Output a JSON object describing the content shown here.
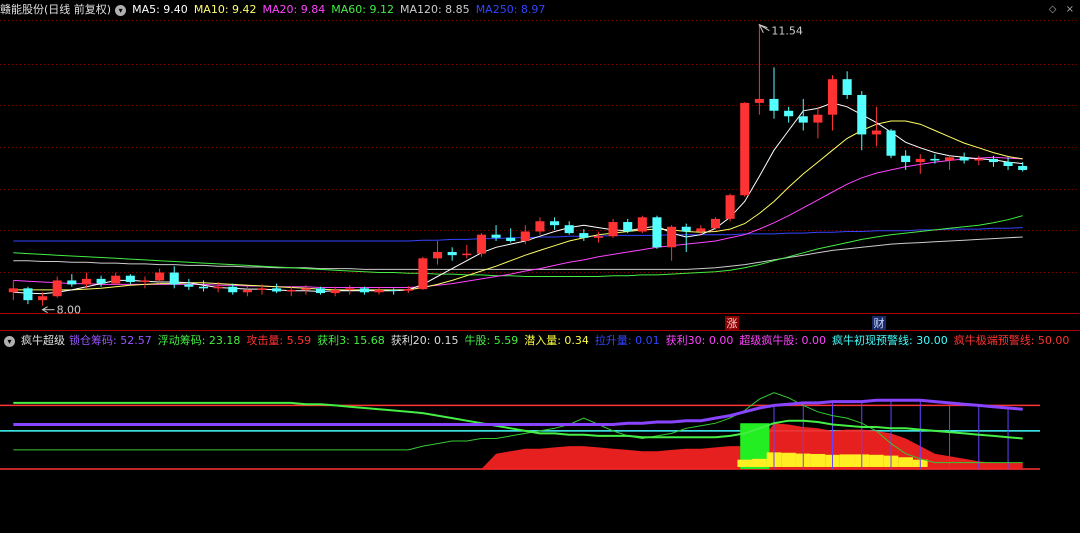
{
  "top": {
    "stock_name": "赣能股份(日线 前复权)",
    "ma": [
      {
        "label": "MA5: 9.40",
        "color": "#ffffff"
      },
      {
        "label": "MA10: 9.42",
        "color": "#ffff66"
      },
      {
        "label": "MA20: 9.84",
        "color": "#ff44ff"
      },
      {
        "label": "MA60: 9.12",
        "color": "#44ee44"
      },
      {
        "label": "MA120: 8.85",
        "color": "#cccccc"
      },
      {
        "label": "MA250: 8.97",
        "color": "#3344ff"
      }
    ],
    "max_label": "11.54",
    "min_label": "8.00",
    "marker_zhang": "涨",
    "marker_cai": "财",
    "corner_up": "◇",
    "corner_close": "×"
  },
  "bottom": {
    "indicator_name": "疯牛超级",
    "items": [
      {
        "label": "锁仓筹码: 52.57",
        "color": "#9955ff"
      },
      {
        "label": "浮动筹码: 23.18",
        "color": "#44ee44"
      },
      {
        "label": "攻击量: 5.59",
        "color": "#ff3333"
      },
      {
        "label": "获利3: 15.68",
        "color": "#44ee44"
      },
      {
        "label": "获利20: 0.15",
        "color": "#dddddd"
      },
      {
        "label": "牛股: 5.59",
        "color": "#44ee44"
      },
      {
        "label": "潜入量: 0.34",
        "color": "#ffff44"
      },
      {
        "label": "拉升量: 0.01",
        "color": "#3344ff"
      },
      {
        "label": "获利30: 0.00",
        "color": "#ff44ff"
      },
      {
        "label": "超级疯牛股: 0.00",
        "color": "#ff44ff"
      },
      {
        "label": "疯牛初现预警线: 30.00",
        "color": "#44ffff"
      },
      {
        "label": "疯牛极端预警线: 50.00",
        "color": "#ff3333"
      }
    ]
  },
  "colors": {
    "up": "#ff3333",
    "down": "#54ffff",
    "grid": "#800000",
    "border": "#aa0000",
    "ma5": "#ffffff",
    "ma10": "#ffff66",
    "ma20": "#ff44ff",
    "ma60": "#44ee44",
    "ma120": "#cccccc",
    "ma250": "#3344ff"
  },
  "chart_data": {
    "type": "candlestick",
    "price_range": [
      7.9,
      11.6
    ],
    "candles": [
      [
        8.15,
        8.3,
        8.05,
        8.2
      ],
      [
        8.2,
        8.22,
        8.0,
        8.05
      ],
      [
        8.05,
        8.15,
        7.98,
        8.1
      ],
      [
        8.1,
        8.35,
        8.08,
        8.3
      ],
      [
        8.3,
        8.38,
        8.22,
        8.25
      ],
      [
        8.25,
        8.4,
        8.2,
        8.32
      ],
      [
        8.32,
        8.36,
        8.22,
        8.26
      ],
      [
        8.26,
        8.4,
        8.24,
        8.36
      ],
      [
        8.36,
        8.38,
        8.25,
        8.28
      ],
      [
        8.28,
        8.35,
        8.2,
        8.3
      ],
      [
        8.3,
        8.45,
        8.26,
        8.4
      ],
      [
        8.4,
        8.48,
        8.2,
        8.25
      ],
      [
        8.25,
        8.32,
        8.18,
        8.22
      ],
      [
        8.22,
        8.3,
        8.16,
        8.2
      ],
      [
        8.2,
        8.28,
        8.15,
        8.22
      ],
      [
        8.22,
        8.26,
        8.12,
        8.15
      ],
      [
        8.15,
        8.22,
        8.1,
        8.18
      ],
      [
        8.18,
        8.25,
        8.12,
        8.2
      ],
      [
        8.2,
        8.26,
        8.14,
        8.16
      ],
      [
        8.16,
        8.22,
        8.1,
        8.18
      ],
      [
        8.18,
        8.24,
        8.12,
        8.2
      ],
      [
        8.2,
        8.22,
        8.12,
        8.14
      ],
      [
        8.14,
        8.22,
        8.1,
        8.18
      ],
      [
        8.18,
        8.24,
        8.12,
        8.2
      ],
      [
        8.2,
        8.22,
        8.12,
        8.15
      ],
      [
        8.15,
        8.22,
        8.12,
        8.18
      ],
      [
        8.18,
        8.2,
        8.12,
        8.17
      ],
      [
        8.17,
        8.23,
        8.14,
        8.19
      ],
      [
        8.19,
        8.6,
        8.18,
        8.58
      ],
      [
        8.58,
        8.8,
        8.5,
        8.66
      ],
      [
        8.66,
        8.72,
        8.55,
        8.62
      ],
      [
        8.62,
        8.75,
        8.58,
        8.64
      ],
      [
        8.64,
        8.9,
        8.6,
        8.88
      ],
      [
        8.88,
        9.0,
        8.8,
        8.84
      ],
      [
        8.84,
        8.96,
        8.78,
        8.8
      ],
      [
        8.8,
        9.0,
        8.76,
        8.92
      ],
      [
        8.92,
        9.1,
        8.88,
        9.05
      ],
      [
        9.05,
        9.1,
        8.94,
        9.0
      ],
      [
        9.0,
        9.05,
        8.88,
        8.9
      ],
      [
        8.9,
        8.95,
        8.8,
        8.84
      ],
      [
        8.84,
        8.92,
        8.78,
        8.86
      ],
      [
        8.86,
        9.08,
        8.84,
        9.04
      ],
      [
        9.04,
        9.08,
        8.9,
        8.92
      ],
      [
        8.92,
        9.12,
        8.9,
        9.1
      ],
      [
        9.1,
        9.12,
        8.7,
        8.72
      ],
      [
        8.72,
        9.0,
        8.55,
        8.98
      ],
      [
        8.98,
        9.02,
        8.66,
        8.92
      ],
      [
        8.92,
        9.0,
        8.88,
        8.96
      ],
      [
        8.96,
        9.1,
        8.94,
        9.08
      ],
      [
        9.08,
        9.4,
        9.05,
        9.38
      ],
      [
        9.38,
        10.56,
        9.36,
        10.55
      ],
      [
        10.55,
        11.54,
        10.4,
        10.6
      ],
      [
        10.6,
        11.0,
        10.35,
        10.45
      ],
      [
        10.45,
        10.5,
        10.3,
        10.38
      ],
      [
        10.38,
        10.6,
        10.2,
        10.3
      ],
      [
        10.3,
        10.5,
        10.1,
        10.4
      ],
      [
        10.4,
        10.9,
        10.2,
        10.85
      ],
      [
        10.85,
        10.95,
        10.6,
        10.65
      ],
      [
        10.65,
        10.7,
        9.95,
        10.15
      ],
      [
        10.15,
        10.5,
        10.0,
        10.2
      ],
      [
        10.2,
        10.22,
        9.85,
        9.88
      ],
      [
        9.88,
        9.95,
        9.7,
        9.8
      ],
      [
        9.8,
        9.9,
        9.65,
        9.84
      ],
      [
        9.84,
        9.9,
        9.78,
        9.82
      ],
      [
        9.82,
        9.88,
        9.7,
        9.86
      ],
      [
        9.86,
        9.92,
        9.78,
        9.82
      ],
      [
        9.82,
        9.88,
        9.76,
        9.84
      ],
      [
        9.84,
        9.88,
        9.74,
        9.8
      ],
      [
        9.8,
        9.86,
        9.7,
        9.75
      ],
      [
        9.75,
        9.8,
        9.68,
        9.7
      ]
    ],
    "ma5": [
      8.15,
      8.14,
      8.13,
      8.15,
      8.18,
      8.22,
      8.26,
      8.3,
      8.3,
      8.29,
      8.28,
      8.28,
      8.27,
      8.24,
      8.21,
      8.2,
      8.19,
      8.19,
      8.18,
      8.17,
      8.17,
      8.16,
      8.17,
      8.17,
      8.17,
      8.17,
      8.17,
      8.18,
      8.25,
      8.35,
      8.45,
      8.55,
      8.65,
      8.72,
      8.76,
      8.8,
      8.86,
      8.92,
      8.97,
      9.0,
      8.97,
      8.94,
      8.93,
      8.96,
      8.99,
      8.9,
      8.85,
      8.88,
      8.96,
      9.1,
      9.3,
      9.62,
      9.95,
      10.2,
      10.45,
      10.48,
      10.55,
      10.5,
      10.4,
      10.3,
      10.18,
      10.05,
      9.98,
      9.92,
      9.88,
      9.86,
      9.84,
      9.83,
      9.8,
      9.78
    ],
    "ma10": [
      8.18,
      8.18,
      8.18,
      8.18,
      8.18,
      8.19,
      8.2,
      8.22,
      8.24,
      8.25,
      8.26,
      8.26,
      8.27,
      8.27,
      8.26,
      8.25,
      8.24,
      8.23,
      8.22,
      8.21,
      8.2,
      8.19,
      8.18,
      8.18,
      8.18,
      8.18,
      8.18,
      8.18,
      8.21,
      8.25,
      8.3,
      8.36,
      8.42,
      8.48,
      8.55,
      8.62,
      8.68,
      8.74,
      8.8,
      8.84,
      8.88,
      8.9,
      8.92,
      8.94,
      8.95,
      8.94,
      8.92,
      8.91,
      8.92,
      8.95,
      9.02,
      9.15,
      9.3,
      9.48,
      9.65,
      9.8,
      9.95,
      10.1,
      10.2,
      10.28,
      10.32,
      10.32,
      10.28,
      10.2,
      10.12,
      10.04,
      9.98,
      9.92,
      9.87,
      9.84
    ],
    "ma20": [
      8.3,
      8.29,
      8.28,
      8.27,
      8.26,
      8.26,
      8.25,
      8.25,
      8.25,
      8.25,
      8.25,
      8.25,
      8.25,
      8.25,
      8.24,
      8.24,
      8.23,
      8.23,
      8.22,
      8.22,
      8.22,
      8.21,
      8.21,
      8.21,
      8.21,
      8.21,
      8.21,
      8.21,
      8.22,
      8.24,
      8.26,
      8.29,
      8.32,
      8.35,
      8.38,
      8.42,
      8.45,
      8.49,
      8.53,
      8.56,
      8.6,
      8.63,
      8.66,
      8.69,
      8.72,
      8.74,
      8.76,
      8.78,
      8.8,
      8.84,
      8.88,
      8.95,
      9.03,
      9.12,
      9.22,
      9.32,
      9.42,
      9.52,
      9.6,
      9.66,
      9.7,
      9.74,
      9.77,
      9.8,
      9.82,
      9.84,
      9.85,
      9.86,
      9.85,
      9.84
    ],
    "ma60": [
      8.65,
      8.64,
      8.63,
      8.62,
      8.61,
      8.6,
      8.59,
      8.58,
      8.57,
      8.56,
      8.55,
      8.54,
      8.53,
      8.52,
      8.51,
      8.5,
      8.49,
      8.48,
      8.47,
      8.46,
      8.45,
      8.44,
      8.43,
      8.42,
      8.41,
      8.4,
      8.4,
      8.39,
      8.39,
      8.38,
      8.38,
      8.37,
      8.37,
      8.36,
      8.36,
      8.35,
      8.35,
      8.35,
      8.35,
      8.35,
      8.35,
      8.36,
      8.36,
      8.37,
      8.37,
      8.38,
      8.39,
      8.4,
      8.41,
      8.43,
      8.46,
      8.5,
      8.55,
      8.6,
      8.65,
      8.7,
      8.74,
      8.78,
      8.82,
      8.85,
      8.88,
      8.9,
      8.92,
      8.94,
      8.96,
      8.98,
      9.0,
      9.03,
      9.07,
      9.12
    ],
    "ma120": [
      8.55,
      8.55,
      8.54,
      8.54,
      8.53,
      8.53,
      8.52,
      8.52,
      8.51,
      8.51,
      8.5,
      8.5,
      8.49,
      8.49,
      8.48,
      8.48,
      8.47,
      8.47,
      8.46,
      8.46,
      8.46,
      8.45,
      8.45,
      8.45,
      8.44,
      8.44,
      8.44,
      8.44,
      8.44,
      8.44,
      8.44,
      8.44,
      8.44,
      8.44,
      8.44,
      8.44,
      8.44,
      8.44,
      8.44,
      8.44,
      8.44,
      8.44,
      8.44,
      8.44,
      8.44,
      8.44,
      8.44,
      8.45,
      8.46,
      8.48,
      8.5,
      8.53,
      8.56,
      8.59,
      8.62,
      8.65,
      8.68,
      8.7,
      8.72,
      8.74,
      8.76,
      8.77,
      8.78,
      8.79,
      8.8,
      8.81,
      8.82,
      8.83,
      8.84,
      8.85
    ],
    "ma250": [
      8.8,
      8.8,
      8.8,
      8.8,
      8.8,
      8.8,
      8.8,
      8.8,
      8.8,
      8.8,
      8.8,
      8.8,
      8.8,
      8.8,
      8.8,
      8.8,
      8.8,
      8.8,
      8.8,
      8.8,
      8.8,
      8.8,
      8.8,
      8.8,
      8.8,
      8.8,
      8.8,
      8.8,
      8.81,
      8.81,
      8.82,
      8.82,
      8.83,
      8.83,
      8.84,
      8.84,
      8.85,
      8.85,
      8.86,
      8.86,
      8.86,
      8.87,
      8.87,
      8.87,
      8.87,
      8.88,
      8.88,
      8.88,
      8.88,
      8.88,
      8.89,
      8.89,
      8.89,
      8.9,
      8.9,
      8.91,
      8.91,
      8.92,
      8.92,
      8.93,
      8.93,
      8.93,
      8.94,
      8.94,
      8.95,
      8.95,
      8.95,
      8.96,
      8.96,
      8.97
    ],
    "indicator": {
      "range": [
        0,
        70
      ],
      "suocang": [
        35,
        35,
        35,
        35,
        35,
        35,
        35,
        35,
        35,
        35,
        35,
        35,
        35,
        35,
        35,
        35,
        35,
        35,
        35,
        35,
        35,
        35,
        35,
        35,
        35,
        35,
        35,
        35,
        35,
        35,
        35,
        35,
        35,
        35,
        35,
        35,
        35,
        35,
        35,
        35,
        35,
        35,
        36,
        36,
        37,
        37,
        38,
        38,
        40,
        42,
        45,
        48,
        50,
        51,
        52,
        52,
        53,
        53,
        53,
        54,
        54,
        54,
        54,
        53,
        52,
        51,
        50,
        49,
        48,
        47
      ],
      "fudong": [
        52,
        52,
        52,
        52,
        52,
        52,
        52,
        52,
        52,
        52,
        52,
        52,
        52,
        52,
        52,
        52,
        52,
        52,
        52,
        52,
        51,
        51,
        50,
        49,
        48,
        47,
        46,
        45,
        44,
        42,
        40,
        38,
        36,
        34,
        32,
        30,
        28,
        28,
        27,
        27,
        26,
        26,
        26,
        25,
        25,
        25,
        25,
        25,
        25,
        26,
        28,
        32,
        36,
        38,
        38,
        37,
        35,
        34,
        33,
        33,
        32,
        32,
        31,
        30,
        29,
        28,
        27,
        26,
        25,
        24
      ],
      "gongji": [
        0,
        0,
        0,
        0,
        0,
        0,
        0,
        0,
        0,
        0,
        0,
        0,
        0,
        0,
        0,
        0,
        0,
        0,
        0,
        0,
        0,
        0,
        0,
        0,
        0,
        0,
        0,
        0,
        0,
        0,
        0,
        0,
        0,
        12,
        14,
        16,
        16,
        17,
        18,
        18,
        17,
        16,
        15,
        14,
        14,
        15,
        16,
        16,
        17,
        18,
        18,
        20,
        36,
        35,
        33,
        32,
        30,
        31,
        31,
        30,
        28,
        24,
        18,
        12,
        10,
        8,
        6,
        5,
        5,
        5
      ],
      "huoli3": [
        15,
        15,
        15,
        15,
        15,
        15,
        15,
        15,
        15,
        15,
        15,
        15,
        15,
        15,
        15,
        15,
        15,
        15,
        15,
        15,
        15,
        15,
        15,
        15,
        15,
        15,
        15,
        15,
        18,
        20,
        22,
        22,
        24,
        24,
        26,
        28,
        30,
        32,
        35,
        40,
        35,
        30,
        26,
        24,
        26,
        28,
        32,
        34,
        36,
        40,
        46,
        55,
        60,
        56,
        50,
        45,
        42,
        40,
        36,
        30,
        20,
        12,
        8,
        5,
        5,
        5,
        5,
        5,
        5,
        5
      ],
      "warn30": 30,
      "warn50": 50
    }
  }
}
